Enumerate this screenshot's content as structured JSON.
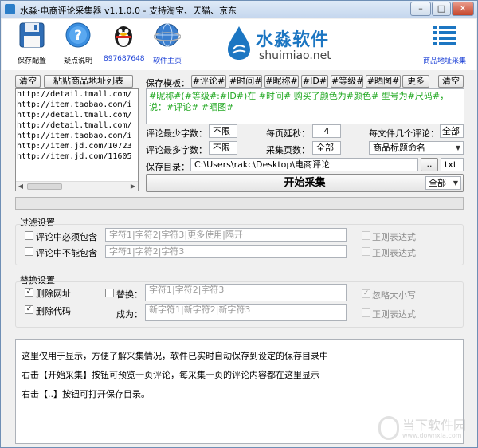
{
  "window": {
    "title": "水淼·电商评论采集器 v1.1.0.0 - 支持淘宝、天猫、京东",
    "minimize": "–",
    "maximize": "□",
    "close": "✕"
  },
  "toolbar": {
    "save_config": "保存配置",
    "help": "疑点说明",
    "qq_number": "897687648",
    "homepage": "软件主页",
    "logo_cn": "水淼软件",
    "logo_en": "shuimiao.net",
    "url_collect": "商品地址采集"
  },
  "left_panel": {
    "clear_label": "清空",
    "paste_label": "粘贴商品地址列表",
    "urls": [
      "http://detail.tmall.com/",
      "http://item.taobao.com/i",
      "http://detail.tmall.com/",
      "http://detail.tmall.com/",
      "http://item.taobao.com/i",
      "http://item.jd.com/10723",
      "http://item.jd.com/11605"
    ]
  },
  "template": {
    "label": "保存模板：",
    "tags": [
      "#评论#",
      "#时间#",
      "#昵称#",
      "#ID#",
      "#等级#",
      "#晒图#"
    ],
    "more_label": "更多",
    "clear_label": "清空",
    "value": "#昵称#(#等级#:#ID#)在 #时间# 购买了颜色为#颜色# 型号为#尺码#，说：#评论# #晒图#"
  },
  "settings": {
    "min_chars_label": "评论最少字数：",
    "min_chars_value": "不限",
    "max_chars_label": "评论最多字数：",
    "max_chars_value": "不限",
    "page_delay_label": "每页延秒：",
    "page_delay_value": "4",
    "pages_label": "采集页数：",
    "pages_value": "全部",
    "per_file_label": "每文件几个评论：",
    "per_file_value": "全部",
    "naming_value": "商品标题命名",
    "save_dir_label": "保存目录：",
    "save_dir_value": "C:\\Users\\rakc\\Desktop\\电商评论",
    "browse_label": "..",
    "ext_value": "txt",
    "start_label": "开始采集",
    "scope_value": "全部"
  },
  "filter": {
    "title": "过滤设置",
    "must_contain_label": "评论中必须包含",
    "must_contain_placeholder": "字符1|字符2|字符3|更多使用|隔开",
    "must_not_contain_label": "评论中不能包含",
    "must_not_contain_placeholder": "字符1|字符2|字符3",
    "regex_label_1": "正则表达式",
    "regex_label_2": "正则表达式"
  },
  "replace": {
    "title": "替换设置",
    "delete_url_label": "删除网址",
    "delete_code_label": "删除代码",
    "replace_label": "替换：",
    "replace_placeholder": "字符1|字符2|字符3",
    "to_label": "成为：",
    "to_placeholder": "新字符1|新字符2|新字符3",
    "ignore_case_label": "忽略大小写",
    "regex_label": "正则表达式"
  },
  "log": {
    "lines": [
      "这里仅用于显示，方便了解采集情况，软件已实时自动保存到设定的保存目录中",
      "右击【开始采集】按钮可预览一页评论，每采集一页的评论内容都在这里显示",
      "右击【..】按钮可打开保存目录。"
    ]
  },
  "watermark": {
    "cn": "当下软件园",
    "en": "www.downxia.com"
  },
  "colors": {
    "template_text": "#22a822",
    "brand_blue": "#1c76c2",
    "link_blue": "#1a3fd6"
  }
}
